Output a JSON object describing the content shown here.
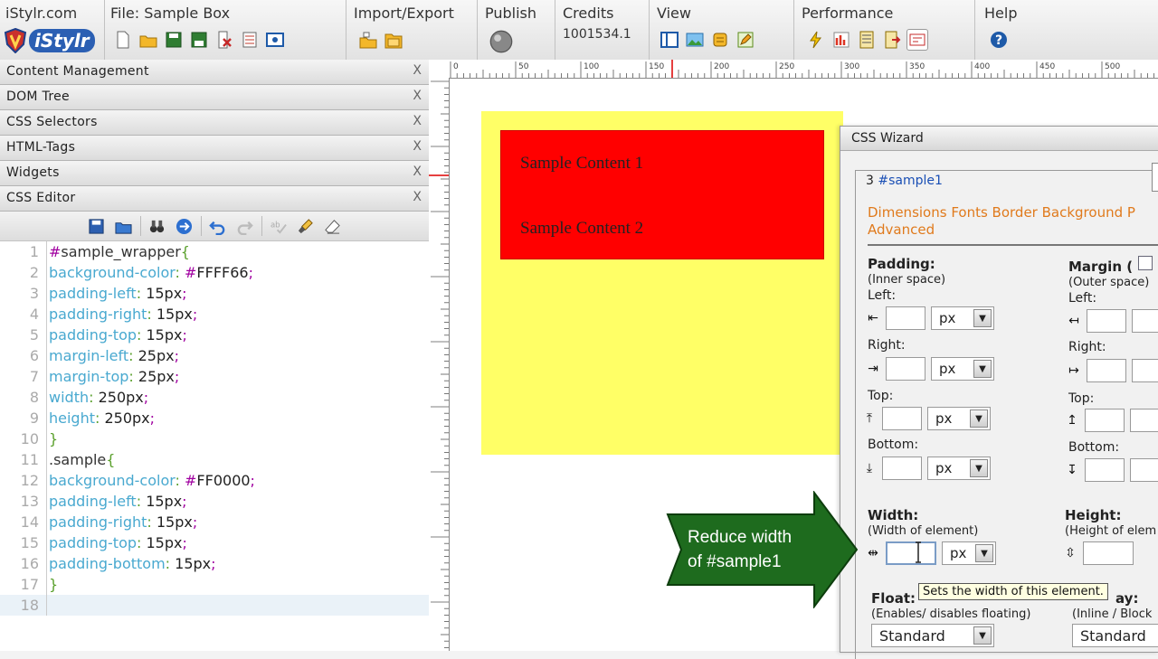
{
  "toolbar": {
    "site": "iStylr.com",
    "logo_text": "iStylr",
    "file": "File: Sample Box",
    "import_export": "Import/Export",
    "publish": "Publish",
    "credits_label": "Credits",
    "credits_value": "1001534.1",
    "view": "View",
    "performance": "Performance",
    "help": "Help"
  },
  "panels": [
    {
      "label": "Content Management",
      "close": "X"
    },
    {
      "label": "DOM Tree",
      "close": "X"
    },
    {
      "label": "CSS Selectors",
      "close": "X"
    },
    {
      "label": "HTML-Tags",
      "close": "X"
    },
    {
      "label": "Widgets",
      "close": "X"
    },
    {
      "label": "CSS Editor",
      "close": "X"
    }
  ],
  "code_lines": [
    {
      "n": "1",
      "sel": "#sample_wrapper",
      "brace": "{"
    },
    {
      "n": "2",
      "prop": "background-color",
      "val": "#FFFF66"
    },
    {
      "n": "3",
      "prop": "padding-left",
      "val": "15px"
    },
    {
      "n": "4",
      "prop": "padding-right",
      "val": "15px"
    },
    {
      "n": "5",
      "prop": "padding-top",
      "val": "15px"
    },
    {
      "n": "6",
      "prop": "margin-left",
      "val": "25px"
    },
    {
      "n": "7",
      "prop": "margin-top",
      "val": "25px"
    },
    {
      "n": "8",
      "prop": "width",
      "val": "250px"
    },
    {
      "n": "9",
      "prop": "height",
      "val": "250px"
    },
    {
      "n": "10",
      "close": "}"
    },
    {
      "n": "11",
      "sel": ".sample",
      "brace": "{"
    },
    {
      "n": "12",
      "prop": "background-color",
      "val": "#FF0000"
    },
    {
      "n": "13",
      "prop": "padding-left",
      "val": "15px"
    },
    {
      "n": "14",
      "prop": "padding-right",
      "val": "15px"
    },
    {
      "n": "15",
      "prop": "padding-top",
      "val": "15px"
    },
    {
      "n": "16",
      "prop": "padding-bottom",
      "val": "15px"
    },
    {
      "n": "17",
      "close": "}"
    },
    {
      "n": "18"
    }
  ],
  "ruler_marks": [
    "0",
    "50",
    "100",
    "150",
    "200",
    "250",
    "300",
    "350",
    "400",
    "450",
    "500"
  ],
  "preview": {
    "content1": "Sample Content 1",
    "content2": "Sample Content 2"
  },
  "wizard": {
    "title": "CSS Wizard",
    "selector_index": "3",
    "selector": "#sample1",
    "tabs_line1": "Dimensions Fonts Border Background P",
    "tabs_line2": "Advanced",
    "padding_label": "Padding:",
    "padding_sub": "(Inner space)",
    "margin_label": "Margin (",
    "margin_sub": "(Outer space)",
    "left": "Left:",
    "right": "Right:",
    "top": "Top:",
    "bottom": "Bottom:",
    "unit": "px",
    "width_label": "Width:",
    "width_sub": "(Width of element)",
    "height_label": "Height:",
    "height_sub": "(Height of elem",
    "float_label": "Float:",
    "float_sub": "(Enables/ disables floating)",
    "display_label": "ay:",
    "display_sub": "(Inline / Block",
    "float_value": "Standard",
    "display_value": "Standard",
    "tooltip": "Sets the width of this element."
  },
  "callout": {
    "line1": "Reduce width",
    "line2": "of #sample1",
    "color": "#1e6b1e"
  },
  "colors": {
    "wrapper": "#FFFF66",
    "sample": "#FF0000",
    "accent": "#e07a1c"
  }
}
